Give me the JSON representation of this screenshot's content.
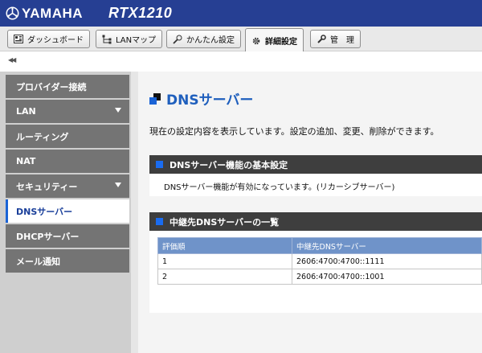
{
  "header": {
    "brand": "YAMAHA",
    "model": "RTX1210"
  },
  "tabs": [
    {
      "label": "ダッシュボード",
      "icon": "dashboard-icon"
    },
    {
      "label": "LANマップ",
      "icon": "lan-map-icon"
    },
    {
      "label": "かんたん設定",
      "icon": "wand-icon"
    },
    {
      "label": "詳細設定",
      "icon": "gear-icon",
      "active": true
    },
    {
      "label": "管　理",
      "icon": "wrench-icon"
    }
  ],
  "collapse_label": "◀◀",
  "sidebar": {
    "items": [
      {
        "label": "プロバイダー接続"
      },
      {
        "label": "LAN",
        "has_arrow": true
      },
      {
        "label": "ルーティング"
      },
      {
        "label": "NAT"
      },
      {
        "label": "セキュリティー",
        "has_arrow": true
      },
      {
        "label": "DNSサーバー",
        "active": true
      },
      {
        "label": "DHCPサーバー"
      },
      {
        "label": "メール通知"
      }
    ]
  },
  "main": {
    "title": "DNSサーバー",
    "description": "現在の設定内容を表示しています。設定の追加、変更、削除ができます。",
    "basic": {
      "header": "DNSサーバー機能の基本設定",
      "status": "DNSサーバー機能が有効になっています。(リカーシブサーバー)"
    },
    "relay": {
      "header": "中継先DNSサーバーの一覧",
      "columns": [
        "評価順",
        "中継先DNSサーバー"
      ],
      "rows": [
        [
          "1",
          "2606:4700:4700::1111"
        ],
        [
          "2",
          "2606:4700:4700::1001"
        ]
      ]
    }
  },
  "colors": {
    "header_bg": "#263f93",
    "accent": "#1a6cf0",
    "table_header": "#6f93c9"
  }
}
